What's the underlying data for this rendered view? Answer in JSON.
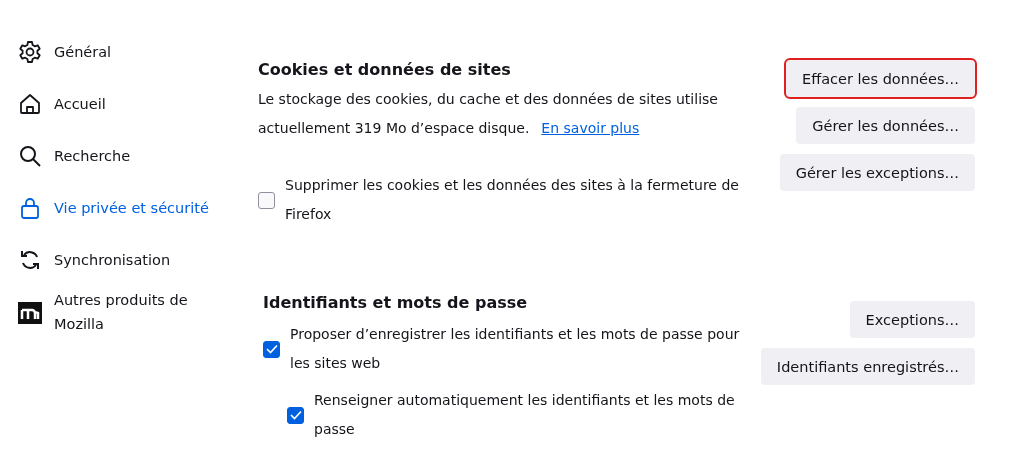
{
  "sidebar": {
    "items": [
      {
        "label": "Général",
        "selected": false
      },
      {
        "label": "Accueil",
        "selected": false
      },
      {
        "label": "Recherche",
        "selected": false
      },
      {
        "label": "Vie privée et sécurité",
        "selected": true
      },
      {
        "label": "Synchronisation",
        "selected": false
      },
      {
        "label": "Autres produits de Mozilla",
        "selected": false
      }
    ]
  },
  "cookies": {
    "heading": "Cookies et données de sites",
    "description": "Le stockage des cookies, du cache et des données de sites utilise actuellement 319 Mo d’espace disque.",
    "link": "En savoir plus",
    "checkbox": {
      "label": "Supprimer les cookies et les données des sites à la fermeture de Firefox",
      "checked": false
    },
    "buttons": [
      {
        "label": "Effacer les données…",
        "highlighted": true
      },
      {
        "label": "Gérer les données…",
        "highlighted": false
      },
      {
        "label": "Gérer les exceptions…",
        "highlighted": false
      }
    ]
  },
  "logins": {
    "heading": "Identifiants et mots de passe",
    "checkboxes": [
      {
        "label": "Proposer d’enregistrer les identifiants et les mots de passe pour les sites web",
        "checked": true
      },
      {
        "label": "Renseigner automatiquement les identifiants et les mots de passe",
        "checked": true
      }
    ],
    "buttons": [
      {
        "label": "Exceptions…",
        "highlighted": false
      },
      {
        "label": "Identifiants enregistrés…",
        "highlighted": false
      }
    ]
  }
}
